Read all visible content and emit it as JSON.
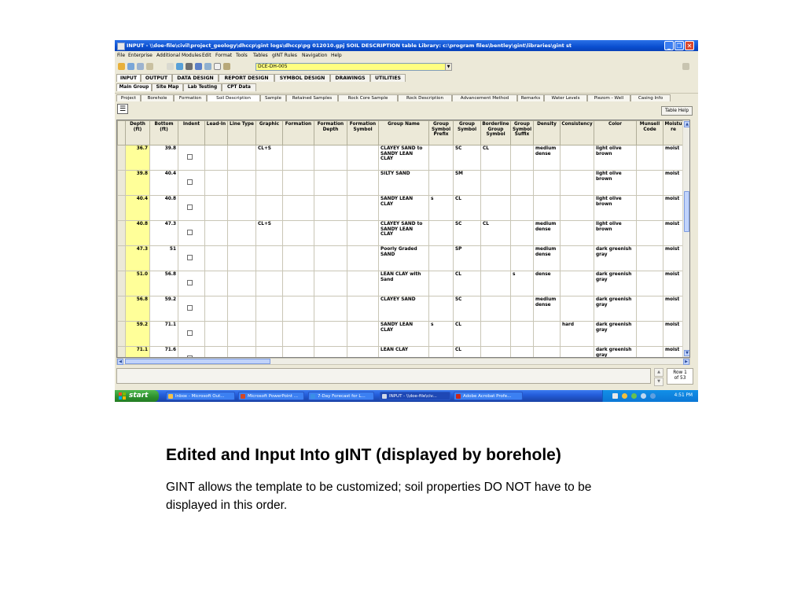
{
  "window": {
    "title": "INPUT -  \\\\doe-file\\civil\\project_geology\\dhccp\\gint logs\\dhccp\\pg 012010.gpj  SOIL DESCRIPTION table  Library: c:\\program files\\bentley\\gint\\libraries\\gint st"
  },
  "menu": [
    "File",
    "Enterprise",
    "Additional Modules",
    "Edit",
    "Format",
    "Tools",
    "Tables",
    "gINT Rules",
    "Navigation",
    "Help"
  ],
  "toolbar": {
    "record_value": "DCE-DH-005"
  },
  "main_tabs": [
    "INPUT",
    "OUTPUT",
    "DATA DESIGN",
    "REPORT DESIGN",
    "SYMBOL DESIGN",
    "DRAWINGS",
    "UTILITIES"
  ],
  "group_tabs": [
    "Main Group",
    "Site Map",
    "Lab Testing",
    "CPT Data"
  ],
  "table_tabs": [
    "Project",
    "Borehole",
    "Formation",
    "Soil Description",
    "Sample",
    "Retained Samples",
    "Rock Core Sample",
    "Rock Description",
    "Advancement Method",
    "Remarks",
    "Water Levels",
    "Piezom - Well",
    "Casing Info"
  ],
  "table_help_label": "Table Help",
  "grid": {
    "columns": [
      "Depth (ft)",
      "Bottom (ft)",
      "Indent",
      "Lead-In",
      "Line Type",
      "Graphic",
      "Formation",
      "Formation Depth",
      "Formation Symbol",
      "Group Name",
      "Group Symbol Prefix",
      "Group Symbol",
      "Borderline Group Symbol",
      "Group Symbol Suffix",
      "Density",
      "Consistency",
      "Color",
      "Munsell Code",
      "Moistu re"
    ],
    "rows": [
      {
        "depth": "36.7",
        "bottom": "39.8",
        "graphic": "CL+S",
        "group_name": "CLAYEY SAND to SANDY LEAN CLAY",
        "prefix": "",
        "symbol": "SC",
        "borderline": "CL",
        "suffix": "",
        "density": "medium dense",
        "consistency": "",
        "color": "light olive brown",
        "moisture": "moist"
      },
      {
        "depth": "39.8",
        "bottom": "40.4",
        "graphic": "",
        "group_name": "SILTY SAND",
        "prefix": "",
        "symbol": "SM",
        "borderline": "",
        "suffix": "",
        "density": "",
        "consistency": "",
        "color": "light olive brown",
        "moisture": "moist"
      },
      {
        "depth": "40.4",
        "bottom": "40.8",
        "graphic": "",
        "group_name": "SANDY LEAN CLAY",
        "prefix": "s",
        "symbol": "CL",
        "borderline": "",
        "suffix": "",
        "density": "",
        "consistency": "",
        "color": "light olive brown",
        "moisture": "moist"
      },
      {
        "depth": "40.8",
        "bottom": "47.3",
        "graphic": "CL+S",
        "group_name": "CLAYEY SAND to SANDY LEAN CLAY",
        "prefix": "",
        "symbol": "SC",
        "borderline": "CL",
        "suffix": "",
        "density": "medium dense",
        "consistency": "",
        "color": "light olive brown",
        "moisture": "moist"
      },
      {
        "depth": "47.3",
        "bottom": "51",
        "graphic": "",
        "group_name": "Poorly Graded SAND",
        "prefix": "",
        "symbol": "SP",
        "borderline": "",
        "suffix": "",
        "density": "medium dense",
        "consistency": "",
        "color": "dark greenish gray",
        "moisture": "moist"
      },
      {
        "depth": "51.0",
        "bottom": "56.8",
        "graphic": "",
        "group_name": "LEAN CLAY with Sand",
        "prefix": "",
        "symbol": "CL",
        "borderline": "",
        "suffix": "s",
        "density": "dense",
        "consistency": "",
        "color": "dark greenish gray",
        "moisture": "moist"
      },
      {
        "depth": "56.8",
        "bottom": "59.2",
        "graphic": "",
        "group_name": "CLAYEY SAND",
        "prefix": "",
        "symbol": "SC",
        "borderline": "",
        "suffix": "",
        "density": "medium dense",
        "consistency": "",
        "color": "dark greenish gray",
        "moisture": "moist"
      },
      {
        "depth": "59.2",
        "bottom": "71.1",
        "graphic": "",
        "group_name": "SANDY LEAN CLAY",
        "prefix": "s",
        "symbol": "CL",
        "borderline": "",
        "suffix": "",
        "density": "",
        "consistency": "hard",
        "color": "dark greenish gray",
        "moisture": "moist"
      },
      {
        "depth": "71.1",
        "bottom": "71.6",
        "graphic": "",
        "group_name": "LEAN CLAY",
        "prefix": "",
        "symbol": "CL",
        "borderline": "",
        "suffix": "",
        "density": "",
        "consistency": "",
        "color": "dark greenish gray",
        "moisture": "moist"
      }
    ]
  },
  "status": {
    "row_label": "Row 1",
    "row_of": "of 53"
  },
  "taskbar": {
    "start_label": "start",
    "tasks": [
      "Inbox - Microsoft Out...",
      "Microsoft PowerPoint ...",
      "7-Day Forecast for L...",
      "INPUT - \\\\doe-file\\civ...",
      "Adobe Acrobat Profe..."
    ],
    "clock": "4:51 PM"
  },
  "slide": {
    "heading": "Edited and Input Into gINT (displayed by borehole)",
    "body": "GINT allows the template to be customized; soil properties DO NOT have to be displayed in this order."
  }
}
